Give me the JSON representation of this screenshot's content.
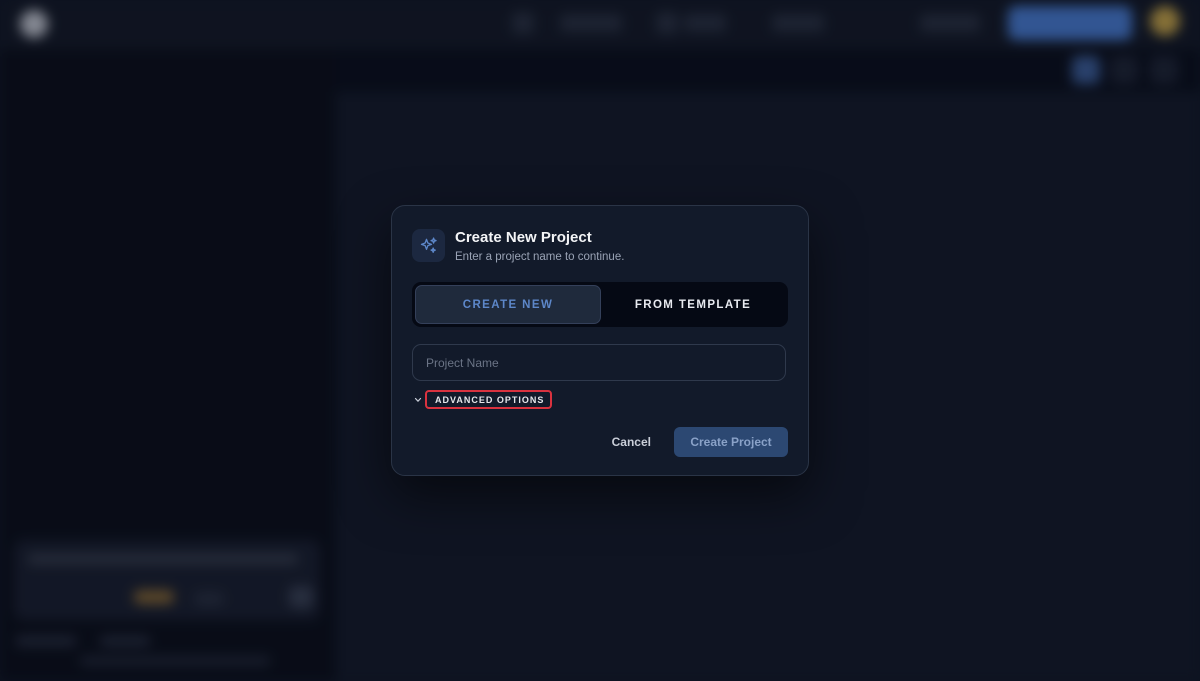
{
  "modal": {
    "title": "Create New Project",
    "subtitle": "Enter a project name to continue.",
    "icon": "sparkles-icon",
    "tabs": [
      {
        "label": "CREATE NEW",
        "active": true
      },
      {
        "label": "FROM TEMPLATE",
        "active": false
      }
    ],
    "project_name": {
      "value": "",
      "placeholder": "Project Name"
    },
    "advanced_options_label": "ADVANCED OPTIONS",
    "cancel_label": "Cancel",
    "create_label": "Create Project"
  },
  "colors": {
    "accent": "#5d87c9",
    "primary_button": "#2c4872",
    "highlight_border": "#d9323f",
    "modal_bg": "#121a2a"
  }
}
